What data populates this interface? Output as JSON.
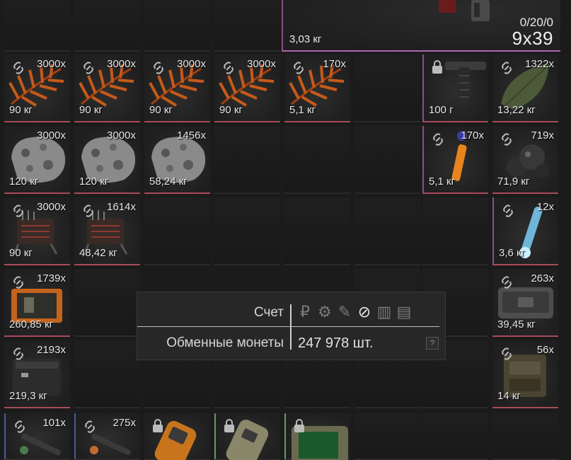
{
  "ammo": {
    "counter": "0/20/0",
    "caliber": "9x39",
    "weight": "3,03 кг"
  },
  "items": [
    {
      "count": "3000x",
      "weight": "90 кг",
      "icon": "fern-icon"
    },
    {
      "count": "3000x",
      "weight": "90 кг",
      "icon": "fern-icon"
    },
    {
      "count": "3000x",
      "weight": "90 кг",
      "icon": "fern-icon"
    },
    {
      "count": "3000x",
      "weight": "90 кг",
      "icon": "fern-icon"
    },
    {
      "count": "170x",
      "weight": "5,1 кг",
      "icon": "fern-icon"
    },
    {
      "count": "",
      "weight": "100 г",
      "icon": "grip-icon"
    },
    {
      "count": "1322x",
      "weight": "13,22 кг",
      "icon": "leaf-icon"
    },
    {
      "count": "3000x",
      "weight": "120 кг",
      "icon": "ore-icon"
    },
    {
      "count": "3000x",
      "weight": "120 кг",
      "icon": "ore-icon"
    },
    {
      "count": "1456x",
      "weight": "58,24 кг",
      "icon": "ore-icon"
    },
    {
      "count": "170x",
      "weight": "5,1 кг",
      "icon": "syringe-icon"
    },
    {
      "count": "719x",
      "weight": "71,9 кг",
      "icon": "slime-icon"
    },
    {
      "count": "3000x",
      "weight": "90 кг",
      "icon": "device-icon"
    },
    {
      "count": "1614x",
      "weight": "48,42 кг",
      "icon": "device-icon"
    },
    {
      "count": "12x",
      "weight": "3,6 кг",
      "icon": "injector-icon"
    },
    {
      "count": "1739x",
      "weight": "260,85 кг",
      "icon": "case-icon"
    },
    {
      "count": "263x",
      "weight": "39,45 кг",
      "icon": "crate-icon"
    },
    {
      "count": "2193x",
      "weight": "219,3 кг",
      "icon": "battery-icon"
    },
    {
      "count": "56x",
      "weight": "14 кг",
      "icon": "can-icon"
    },
    {
      "count": "101x",
      "weight": "",
      "icon": "shell-icon"
    },
    {
      "count": "275x",
      "weight": "",
      "icon": "shell-icon"
    },
    {
      "count": "",
      "weight": "",
      "icon": "scanner-icon"
    },
    {
      "count": "",
      "weight": "",
      "icon": "detector-icon"
    },
    {
      "count": "",
      "weight": "",
      "icon": "terminal-icon"
    }
  ],
  "tooltip": {
    "account_label": "Счет",
    "currency_label": "Обменные монеты",
    "currency_value": "247 978 шт.",
    "help_label": "?",
    "currency_icons": [
      {
        "name": "ruble-icon",
        "glyph": "₽"
      },
      {
        "name": "gear-icon",
        "glyph": "⚙"
      },
      {
        "name": "feather-icon",
        "glyph": "✎"
      },
      {
        "name": "exchange-coin-icon",
        "glyph": "⊘"
      },
      {
        "name": "bar-icon",
        "glyph": "▥"
      },
      {
        "name": "token-icon",
        "glyph": "▤"
      }
    ]
  }
}
